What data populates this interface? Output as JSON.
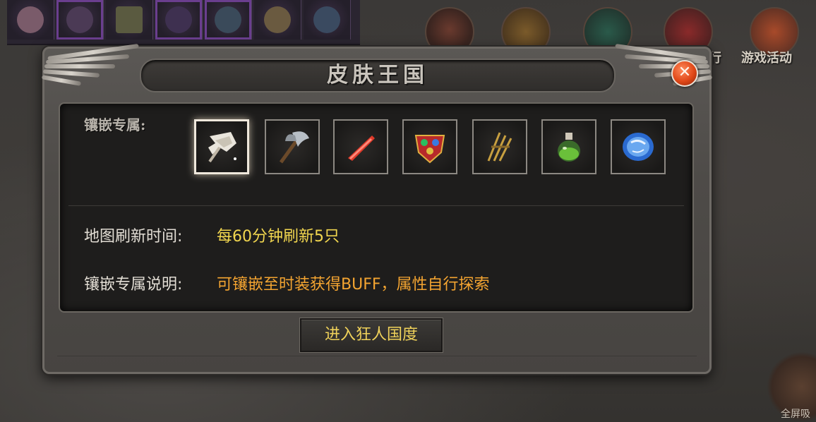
{
  "background": {
    "top_right_labels": [
      "行",
      "游戏活动"
    ],
    "corner_label": "全屏吸"
  },
  "dialog": {
    "title": "皮肤王国",
    "close_icon": "close-x-icon",
    "slots_label": "镶嵌专属:",
    "slots": [
      {
        "name": "winged-axe-icon",
        "selected": true
      },
      {
        "name": "battle-axe-icon",
        "selected": false
      },
      {
        "name": "red-blade-icon",
        "selected": false
      },
      {
        "name": "gem-shield-icon",
        "selected": false
      },
      {
        "name": "golden-claw-icon",
        "selected": false
      },
      {
        "name": "green-potion-icon",
        "selected": false
      },
      {
        "name": "blue-orb-icon",
        "selected": false
      }
    ],
    "refresh_label": "地图刷新时间:",
    "refresh_value": "每60分钟刷新5只",
    "desc_label": "镶嵌专属说明:",
    "desc_value": "可镶嵌至时装获得BUFF，属性自行探索",
    "enter_button": "进入狂人国度"
  },
  "colors": {
    "title": "#c9c4bc",
    "refresh_value": "#f1d64f",
    "desc_value": "#f3a431",
    "button_text": "#f0d25a",
    "close_button": "#e04818"
  }
}
